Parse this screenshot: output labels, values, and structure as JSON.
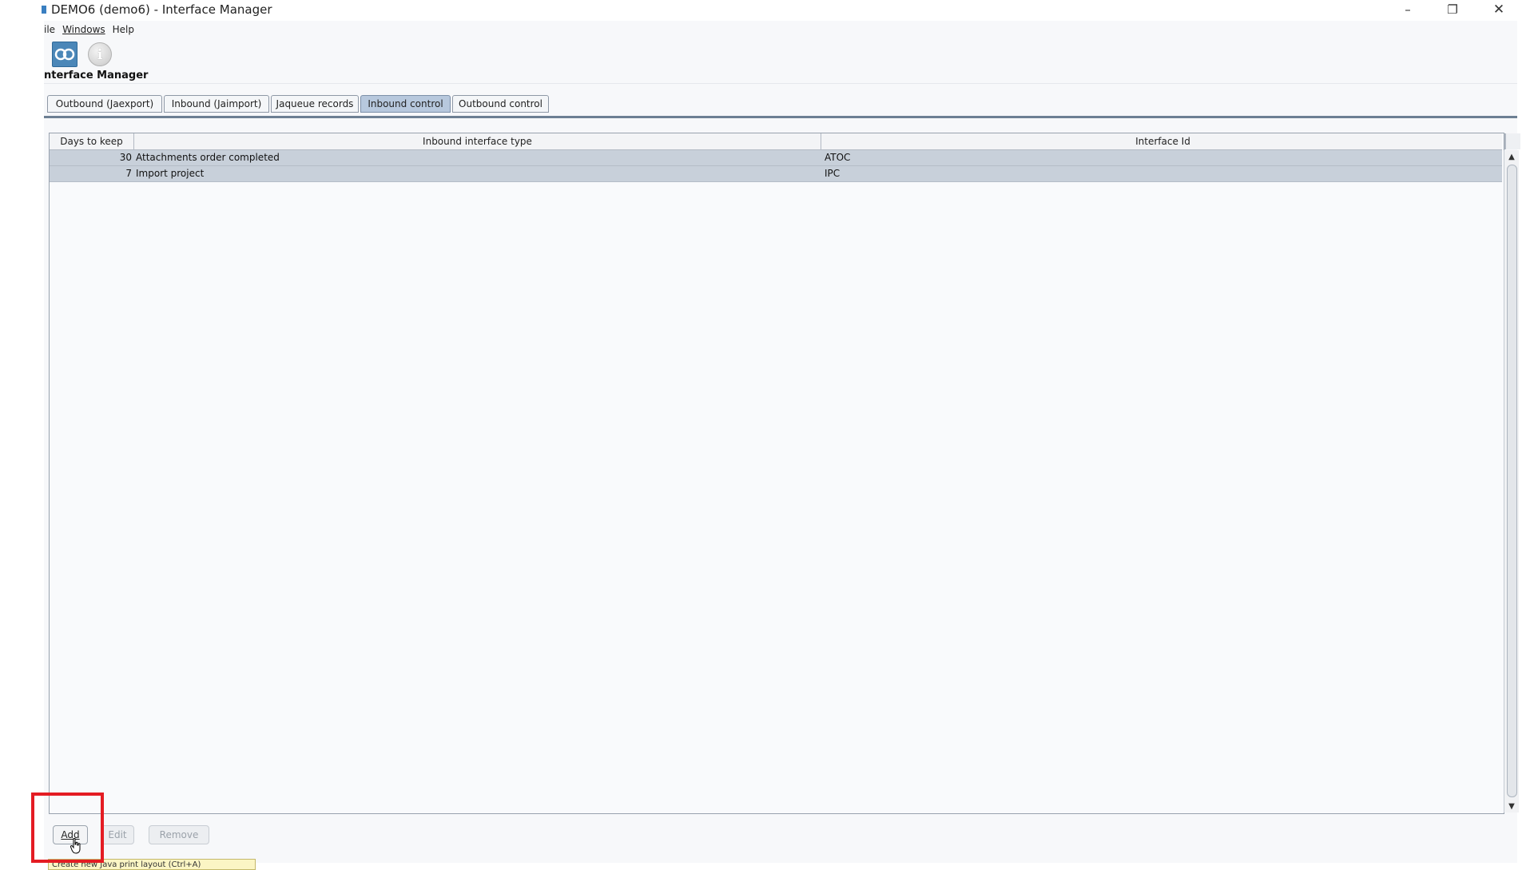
{
  "window": {
    "title": "DEMO6 (demo6) - Interface Manager",
    "controls": {
      "minimize": "–",
      "restore": "❐",
      "close": "✕"
    }
  },
  "menu": {
    "items": [
      "ile",
      "Windows",
      "Help"
    ]
  },
  "toolbar": {
    "logo_icon": "program-logo-icon",
    "info_glyph": "i"
  },
  "panel": {
    "title": "nterface Manager"
  },
  "tabs": [
    {
      "label": "Outbound (Jaexport)",
      "active": false
    },
    {
      "label": "Inbound (Jaimport)",
      "active": false
    },
    {
      "label": "Jaqueue records",
      "active": false
    },
    {
      "label": "Inbound control",
      "active": true
    },
    {
      "label": "Outbound control",
      "active": false
    }
  ],
  "table": {
    "columns": [
      "Days to keep",
      "Inbound interface type",
      "Interface Id"
    ],
    "rows": [
      {
        "days": "30",
        "type": "Attachments order completed",
        "id": "ATOC"
      },
      {
        "days": "7",
        "type": "Import project",
        "id": "IPC"
      }
    ],
    "scroll_up": "▲",
    "scroll_down": "▼"
  },
  "buttons": {
    "add": "Add",
    "edit": "Edit",
    "remove": "Remove"
  },
  "tooltip": {
    "text": "Create new Java print layout (Ctrl+A)"
  },
  "colors": {
    "highlight": "#e41c23",
    "active_tab": "#b7c8dd",
    "selected_row": "#c8d0da"
  }
}
